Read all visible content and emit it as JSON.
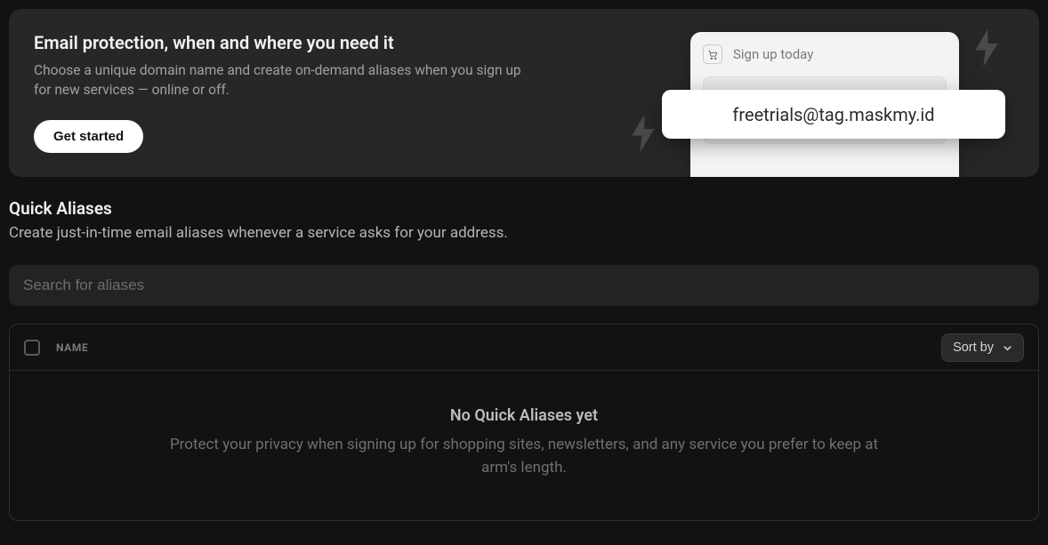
{
  "hero": {
    "title": "Email protection, when and where you need it",
    "subtitle": "Choose a unique domain name and create on-demand aliases when you sign up for new services — online or off.",
    "cta": "Get started",
    "illustration": {
      "signup_label": "Sign up today",
      "generated_email": "freetrials@tag.maskmy.id"
    }
  },
  "section": {
    "title": "Quick Aliases",
    "subtitle": "Create just-in-time email aliases whenever a service asks for your address."
  },
  "search": {
    "placeholder": "Search for aliases"
  },
  "table": {
    "column_name": "NAME",
    "sort_label": "Sort by",
    "empty_title": "No Quick Aliases yet",
    "empty_subtitle": "Protect your privacy when signing up for shopping sites, newsletters, and any service you prefer to keep at arm's length."
  }
}
